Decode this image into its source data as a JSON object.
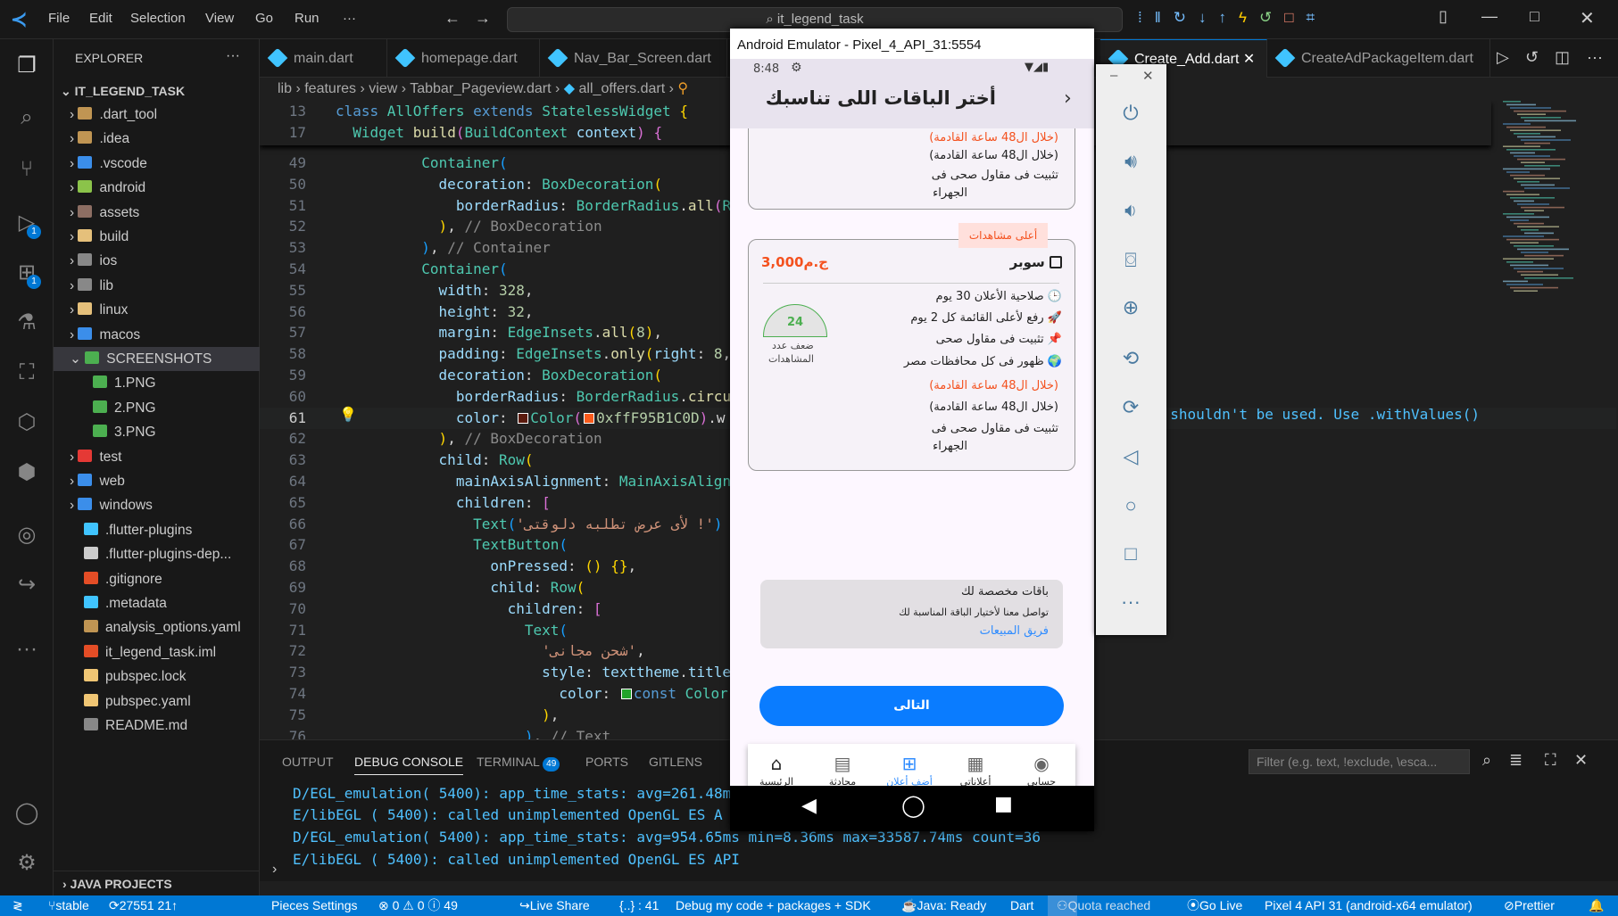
{
  "menu": [
    "File",
    "Edit",
    "Selection",
    "View",
    "Go",
    "Run",
    "···"
  ],
  "search": "it_legend_task",
  "explorer": {
    "title": "EXPLORER",
    "root": "IT_LEGEND_TASK",
    "items": [
      {
        "label": ".dart_tool",
        "type": "folder",
        "color": "#c09553"
      },
      {
        "label": ".idea",
        "type": "folder",
        "color": "#c09553"
      },
      {
        "label": ".vscode",
        "type": "folder",
        "color": "#3b8eea"
      },
      {
        "label": "android",
        "type": "folder",
        "color": "#8bc34a"
      },
      {
        "label": "assets",
        "type": "folder",
        "color": "#8d6e63"
      },
      {
        "label": "build",
        "type": "folder",
        "color": "#e5c07b"
      },
      {
        "label": "ios",
        "type": "folder",
        "color": "#888888"
      },
      {
        "label": "lib",
        "type": "folder",
        "color": "#888888"
      },
      {
        "label": "linux",
        "type": "folder",
        "color": "#e5c07b"
      },
      {
        "label": "macos",
        "type": "folder",
        "color": "#3b8eea"
      },
      {
        "label": "SCREENSHOTS",
        "type": "folder-open",
        "color": "#4caf50",
        "selected": true
      },
      {
        "label": "1.PNG",
        "type": "image",
        "color": "#4caf50",
        "child": true
      },
      {
        "label": "2.PNG",
        "type": "image",
        "color": "#4caf50",
        "child": true
      },
      {
        "label": "3.PNG",
        "type": "image",
        "color": "#4caf50",
        "child": true
      },
      {
        "label": "test",
        "type": "folder",
        "color": "#e53935"
      },
      {
        "label": "web",
        "type": "folder",
        "color": "#3b8eea"
      },
      {
        "label": "windows",
        "type": "folder",
        "color": "#3b8eea"
      },
      {
        "label": ".flutter-plugins",
        "type": "file",
        "color": "#40c4ff"
      },
      {
        "label": ".flutter-plugins-dep...",
        "type": "file",
        "color": "#cccccc"
      },
      {
        "label": ".gitignore",
        "type": "file",
        "color": "#e44d26"
      },
      {
        "label": ".metadata",
        "type": "file",
        "color": "#40c4ff"
      },
      {
        "label": "analysis_options.yaml",
        "type": "file",
        "color": "#c09553"
      },
      {
        "label": "it_legend_task.iml",
        "type": "file",
        "color": "#e44d26"
      },
      {
        "label": "pubspec.lock",
        "type": "file",
        "color": "#f0c674"
      },
      {
        "label": "pubspec.yaml",
        "type": "file",
        "color": "#f0c674"
      },
      {
        "label": "README.md",
        "type": "file",
        "color": "#888888"
      }
    ],
    "java_projects": "JAVA PROJECTS"
  },
  "tabs": [
    "main.dart",
    "homepage.dart",
    "Nav_Bar_Screen.dart",
    "Create_Add.dart",
    "CreateAdPackageItem.dart"
  ],
  "breadcrumbs": [
    "lib",
    "features",
    "view",
    "Tabbar_Pageview.dart",
    "all_offers.dart"
  ],
  "code": [
    {
      "n": "13",
      "i": 0,
      "t": [
        [
          "class ",
          "kw"
        ],
        [
          "AllOffers ",
          "cls"
        ],
        [
          "extends ",
          "kw"
        ],
        [
          "StatelessWidget ",
          "cls"
        ],
        [
          "{",
          "b1"
        ]
      ]
    },
    {
      "n": "17",
      "i": 2,
      "t": [
        [
          "Widget ",
          "cls"
        ],
        [
          "build",
          "fn"
        ],
        [
          "(",
          "b2"
        ],
        [
          "BuildContext ",
          "cls"
        ],
        [
          "context",
          "prop"
        ],
        [
          ")",
          "b2"
        ],
        [
          " {",
          "b2"
        ]
      ]
    },
    {
      "n": "49",
      "i": 10,
      "t": [
        [
          "Container",
          "cls"
        ],
        [
          "(",
          "b3"
        ]
      ]
    },
    {
      "n": "50",
      "i": 12,
      "t": [
        [
          "decoration",
          "prop"
        ],
        [
          ": ",
          "p"
        ],
        [
          "BoxDecoration",
          "cls"
        ],
        [
          "(",
          "b1"
        ]
      ]
    },
    {
      "n": "51",
      "i": 14,
      "t": [
        [
          "borderRadius",
          "prop"
        ],
        [
          ": ",
          "p"
        ],
        [
          "BorderRadius",
          "cls"
        ],
        [
          ".",
          "p"
        ],
        [
          "all",
          "fn"
        ],
        [
          "(",
          "b2"
        ],
        [
          "R",
          "cls"
        ]
      ]
    },
    {
      "n": "52",
      "i": 12,
      "t": [
        [
          ")",
          "b1"
        ],
        [
          ", ",
          "p"
        ],
        [
          "// BoxDecoration",
          "cm"
        ]
      ]
    },
    {
      "n": "53",
      "i": 10,
      "t": [
        [
          ")",
          "b3"
        ],
        [
          ", ",
          "p"
        ],
        [
          "// Container",
          "cm"
        ]
      ]
    },
    {
      "n": "54",
      "i": 10,
      "t": [
        [
          "Container",
          "cls"
        ],
        [
          "(",
          "b3"
        ]
      ]
    },
    {
      "n": "55",
      "i": 12,
      "t": [
        [
          "width",
          "prop"
        ],
        [
          ": ",
          "p"
        ],
        [
          "328",
          "num"
        ],
        [
          ",",
          "p"
        ]
      ]
    },
    {
      "n": "56",
      "i": 12,
      "t": [
        [
          "height",
          "prop"
        ],
        [
          ": ",
          "p"
        ],
        [
          "32",
          "num"
        ],
        [
          ",",
          "p"
        ]
      ]
    },
    {
      "n": "57",
      "i": 12,
      "t": [
        [
          "margin",
          "prop"
        ],
        [
          ": ",
          "p"
        ],
        [
          "EdgeInsets",
          "cls"
        ],
        [
          ".",
          "p"
        ],
        [
          "all",
          "fn"
        ],
        [
          "(",
          "b1"
        ],
        [
          "8",
          "num"
        ],
        [
          ")",
          "b1"
        ],
        [
          ",",
          "p"
        ]
      ]
    },
    {
      "n": "58",
      "i": 12,
      "t": [
        [
          "padding",
          "prop"
        ],
        [
          ": ",
          "p"
        ],
        [
          "EdgeInsets",
          "cls"
        ],
        [
          ".",
          "p"
        ],
        [
          "only",
          "fn"
        ],
        [
          "(",
          "b1"
        ],
        [
          "right",
          "prop"
        ],
        [
          ": ",
          "p"
        ],
        [
          "8",
          "num"
        ],
        [
          ",",
          "p"
        ]
      ]
    },
    {
      "n": "59",
      "i": 12,
      "t": [
        [
          "decoration",
          "prop"
        ],
        [
          ": ",
          "p"
        ],
        [
          "BoxDecoration",
          "cls"
        ],
        [
          "(",
          "b1"
        ]
      ]
    },
    {
      "n": "60",
      "i": 14,
      "t": [
        [
          "borderRadius",
          "prop"
        ],
        [
          ": ",
          "p"
        ],
        [
          "BorderRadius",
          "cls"
        ],
        [
          ".",
          "p"
        ],
        [
          "circu",
          "fn"
        ]
      ]
    },
    {
      "n": "61",
      "i": 14,
      "cur": true,
      "t": [
        [
          "color",
          "prop"
        ],
        [
          ": ",
          "p"
        ],
        [
          "#5a1a0d",
          "sw"
        ],
        [
          "Color",
          "cls"
        ],
        [
          "(",
          "b2"
        ],
        [
          "#f95b1c",
          "sw"
        ],
        [
          "0xffF95B1C0D",
          "num"
        ],
        [
          ")",
          "b2"
        ],
        [
          ".w",
          "p"
        ]
      ]
    },
    {
      "n": "62",
      "i": 12,
      "t": [
        [
          ")",
          "b1"
        ],
        [
          ", ",
          "p"
        ],
        [
          "// BoxDecoration",
          "cm"
        ]
      ]
    },
    {
      "n": "63",
      "i": 12,
      "t": [
        [
          "child",
          "prop"
        ],
        [
          ": ",
          "p"
        ],
        [
          "Row",
          "cls"
        ],
        [
          "(",
          "b1"
        ]
      ]
    },
    {
      "n": "64",
      "i": 14,
      "t": [
        [
          "mainAxisAlignment",
          "prop"
        ],
        [
          ": ",
          "p"
        ],
        [
          "MainAxisAlign",
          "cls"
        ]
      ]
    },
    {
      "n": "65",
      "i": 14,
      "t": [
        [
          "children",
          "prop"
        ],
        [
          ": ",
          "p"
        ],
        [
          "[",
          "b2"
        ]
      ]
    },
    {
      "n": "66",
      "i": 16,
      "t": [
        [
          "Text",
          "cls"
        ],
        [
          "(",
          "b3"
        ],
        [
          "'لأى عرض تطلبه دلوقتى !'",
          "str"
        ],
        [
          ")",
          "b3"
        ]
      ]
    },
    {
      "n": "67",
      "i": 16,
      "t": [
        [
          "TextButton",
          "cls"
        ],
        [
          "(",
          "b3"
        ]
      ]
    },
    {
      "n": "68",
      "i": 18,
      "t": [
        [
          "onPressed",
          "prop"
        ],
        [
          ": ",
          "p"
        ],
        [
          "() {}",
          "b1"
        ],
        [
          ",",
          "p"
        ]
      ]
    },
    {
      "n": "69",
      "i": 18,
      "t": [
        [
          "child",
          "prop"
        ],
        [
          ": ",
          "p"
        ],
        [
          "Row",
          "cls"
        ],
        [
          "(",
          "b1"
        ]
      ]
    },
    {
      "n": "70",
      "i": 20,
      "t": [
        [
          "children",
          "prop"
        ],
        [
          ": ",
          "p"
        ],
        [
          "[",
          "b2"
        ]
      ]
    },
    {
      "n": "71",
      "i": 22,
      "t": [
        [
          "Text",
          "cls"
        ],
        [
          "(",
          "b3"
        ]
      ]
    },
    {
      "n": "72",
      "i": 24,
      "t": [
        [
          "'شحن مجانى'",
          "str"
        ],
        [
          ",",
          "p"
        ]
      ]
    },
    {
      "n": "73",
      "i": 24,
      "t": [
        [
          "style",
          "prop"
        ],
        [
          ": ",
          "p"
        ],
        [
          "texttheme",
          "prop"
        ],
        [
          ".",
          "p"
        ],
        [
          "title",
          "prop"
        ]
      ]
    },
    {
      "n": "74",
      "i": 26,
      "t": [
        [
          "color",
          "prop"
        ],
        [
          ": ",
          "p"
        ],
        [
          "#22a32a",
          "sw"
        ],
        [
          "const ",
          "kw"
        ],
        [
          "Color",
          "cls"
        ]
      ]
    },
    {
      "n": "75",
      "i": 24,
      "t": [
        [
          ")",
          "b1"
        ],
        [
          ",",
          "p"
        ]
      ]
    },
    {
      "n": "76",
      "i": 22,
      "t": [
        [
          ")",
          "b3"
        ],
        [
          ", ",
          "p"
        ],
        [
          "// Text",
          "cm"
        ]
      ]
    }
  ],
  "diagnostic": "d shouldn't be used. Use .withValues()",
  "panel": {
    "tabs": [
      "OUTPUT",
      "DEBUG CONSOLE",
      "TERMINAL",
      "PORTS",
      "GITLENS"
    ],
    "terminal_count": "49",
    "active": "DEBUG CONSOLE",
    "filter_placeholder": "Filter (e.g. text, !exclude, \\esca...",
    "lines": [
      "D/EGL_emulation( 5400): app_time_stats: avg=261.48m",
      "E/libEGL  ( 5400): called unimplemented OpenGL ES A",
      "D/EGL_emulation( 5400): app_time_stats: avg=954.65ms min=8.36ms max=33587.74ms count=36",
      "E/libEGL  ( 5400): called unimplemented OpenGL ES API"
    ]
  },
  "status": {
    "branch": "stable",
    "sync": "27551 21↑",
    "pieces": "Pieces Settings",
    "problems": "⊗ 0 ⚠ 0 ⓘ 49",
    "liveshare": "Live Share",
    "braces": "{..} : 41",
    "debug": "Debug my code + packages + SDK",
    "java": "Java: Ready",
    "lang": "Dart",
    "quota": "Quota reached",
    "golive": "Go Live",
    "device": "Pixel 4 API 31 (android-x64 emulator)",
    "prettier": "Prettier"
  },
  "emulator": {
    "title": "Android Emulator - Pixel_4_API_31:5554",
    "time": "8:48",
    "appbar_title": "أختر الباقات اللى تناسبك",
    "card1": {
      "lines": [
        "(خلال ال48 ساعة القادمة)",
        "(خلال ال48 ساعة القادمة)",
        "تثبيت فى مقاول صحى فى",
        "الجهراء"
      ]
    },
    "badge": "أعلى مشاهدات",
    "card2": {
      "name": "سوبر",
      "price": "3,000ج.م",
      "gauge_value": "24",
      "gauge_label1": "ضعف عدد",
      "gauge_label2": "المشاهدات",
      "features": [
        "صلاحية الأعلان 30 يوم",
        "رفع لأعلى القائمة كل 2 يوم",
        "تثبيت فى مقاول صحى",
        "ظهور فى كل محافظات مصر"
      ],
      "lines": [
        "(خلال ال48 ساعة القادمة)",
        "(خلال ال48 ساعة القادمة)",
        "تثبيت فى مقاول صحى فى",
        "الجهراء"
      ]
    },
    "custom": {
      "title": "باقات مخصصة لك",
      "subtitle": "تواصل معنا لأختيار الباقة المناسبة لك",
      "link": "فريق المبيعات"
    },
    "next_button": "التالى",
    "nav": [
      "حسابى",
      "أعلاناتى",
      "أضف أعلان",
      "محادثة",
      "الرئيسية"
    ],
    "nav_active": "أضف أعلان",
    "colors": {
      "accent": "#0a7cff",
      "price": "#f4511e",
      "gauge": "#4caf50"
    }
  }
}
